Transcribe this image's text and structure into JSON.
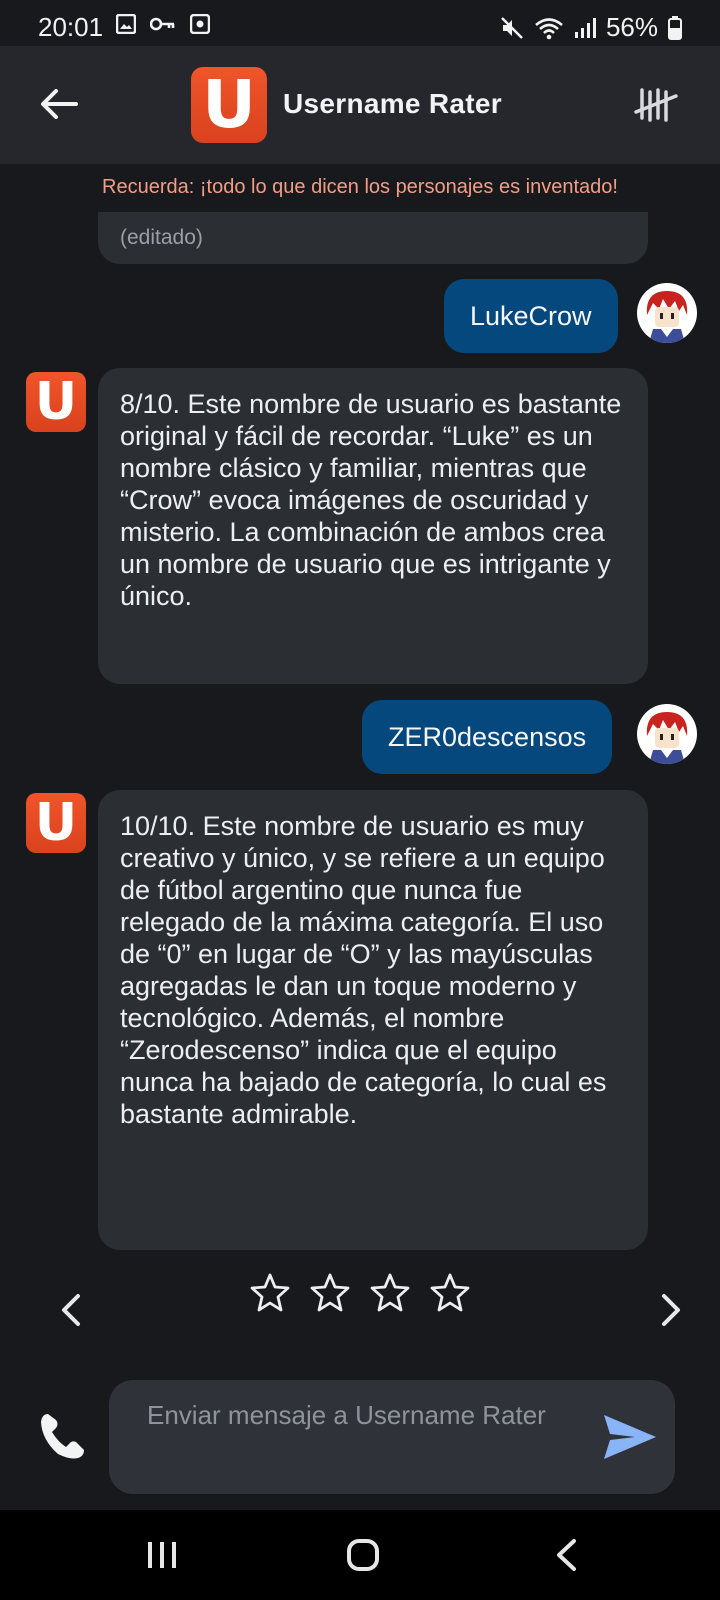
{
  "status_bar": {
    "time": "20:01",
    "battery_text": "56%",
    "icons_left": [
      "image-icon",
      "key-icon",
      "camera-app-icon"
    ],
    "icons_right": [
      "mute-icon",
      "wifi-icon",
      "signal-icon",
      "battery-icon"
    ]
  },
  "app_bar": {
    "logo_letter": "U",
    "title": "Username Rater"
  },
  "disclaimer": "Recuerda: ¡todo lo que dicen los personajes es inventado!",
  "messages": [
    {
      "role": "bot",
      "text": "(editado)"
    },
    {
      "role": "user",
      "text": "LukeCrow"
    },
    {
      "role": "bot",
      "text": "8/10. Este nombre de usuario es bastante original y fácil de recordar. “Luke” es un nombre clásico y familiar, mientras que “Crow” evoca imágenes de oscuridad y misterio. La combinación de ambos crea un nombre de usuario que es intrigante y único."
    },
    {
      "role": "user",
      "text": "ZER0descensos"
    },
    {
      "role": "bot",
      "text": "10/10. Este nombre de usuario es muy creativo y único, y se refiere a un equipo de fútbol argentino que nunca fue relegado de la máxima categoría. El uso de “0” en lugar de “O” y las mayúsculas agregadas le dan un toque moderno y tecnológico. Además, el nombre “Zerodescenso” indica que el equipo nunca ha bajado de categoría, lo cual es bastante admirable."
    }
  ],
  "bot_avatar_letter": "U",
  "rating": {
    "stars_total": 4,
    "stars_filled": 0
  },
  "input": {
    "placeholder": "Enviar mensaje a Username Rater"
  },
  "colors": {
    "accent_orange": "#e54b22",
    "user_bubble": "#05487e",
    "bot_bubble": "#2b2e33",
    "disclaimer": "#f49d85",
    "send_icon": "#8ab4f8"
  }
}
